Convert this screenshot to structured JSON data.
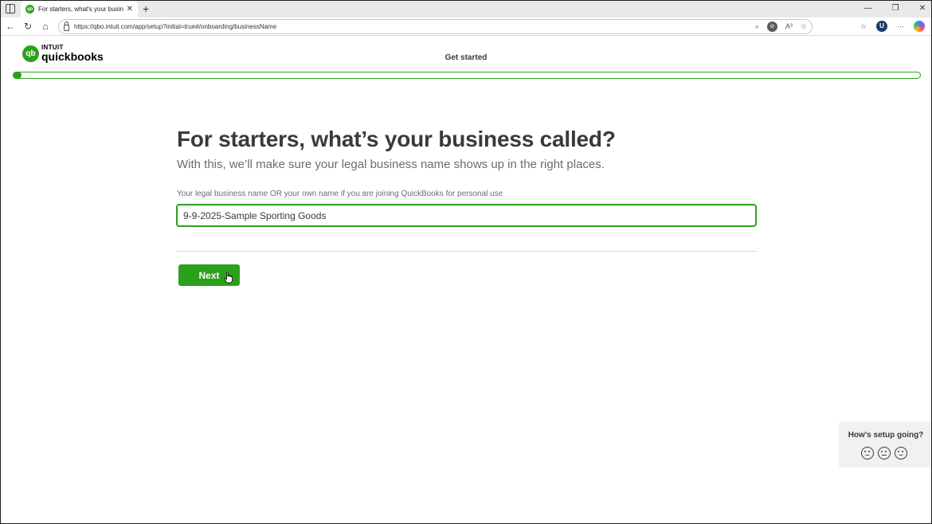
{
  "browser": {
    "tab_title": "For starters, what's your busines",
    "tab_favicon": "qb",
    "new_tab_icon": "+",
    "url": "https://qbo.intuit.com/app/setup?initial=true#/onboarding/businessName",
    "read_aloud_icon": "A³"
  },
  "header": {
    "logo_mark": "qb",
    "logo_intuit": "INTUIT",
    "logo_product": "quickbooks",
    "step_title": "Get started",
    "progress": 0.01
  },
  "main": {
    "heading": "For starters, what’s your business called?",
    "subheading": "With this, we’ll make sure your legal business name shows up in the right places.",
    "field_label": "Your legal business name OR your own name if you are joining QuickBooks for personal use",
    "business_name_value": "9-9-2025-Sample Sporting Goods",
    "next_label": "Next"
  },
  "feedback": {
    "title": "How's setup going?"
  },
  "colors": {
    "brand_green": "#2ca01c",
    "text_dark": "#393a3d",
    "text_muted": "#6b6c72"
  }
}
